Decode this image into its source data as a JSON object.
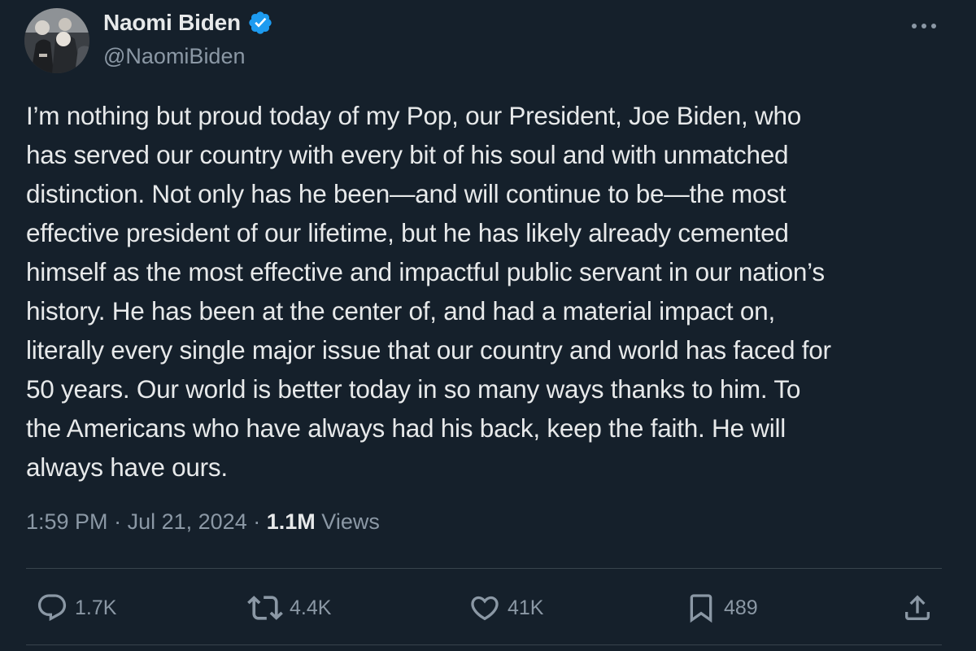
{
  "author": {
    "display_name": "Naomi Biden",
    "handle": "@NaomiBiden",
    "verified_color": "#1d9bf0",
    "avatar_icon": "profile-photo"
  },
  "post": {
    "text": "I’m nothing but proud today of my Pop, our President, Joe Biden, who\nhas served our country with every bit of his soul and with unmatched\ndistinction. Not only has he been—and will continue to be—the most\neffective president of our lifetime, but he has likely already cemented\nhimself as the most effective and impactful public servant in our nation’s\nhistory. He has been at the center of, and had a material impact on,\nliterally every single major issue that our country and world has faced for\n50 years. Our world is better today in so many ways thanks to him. To\nthe Americans who have always had his back, keep the faith. He will\nalways have ours."
  },
  "meta": {
    "time": "1:59 PM",
    "separator": "·",
    "date": "Jul 21, 2024",
    "views_count": "1.1M",
    "views_label": "Views"
  },
  "actions": {
    "replies": {
      "icon": "reply-icon",
      "count": "1.7K"
    },
    "reposts": {
      "icon": "repost-icon",
      "count": "4.4K"
    },
    "likes": {
      "icon": "heart-icon",
      "count": "41K"
    },
    "bookmarks": {
      "icon": "bookmark-icon",
      "count": "489"
    },
    "share": {
      "icon": "share-icon"
    }
  },
  "colors": {
    "background": "#15202b",
    "text_primary": "#e7e9ea",
    "text_secondary": "#8b98a5",
    "divider": "#38444d",
    "accent": "#1d9bf0"
  }
}
